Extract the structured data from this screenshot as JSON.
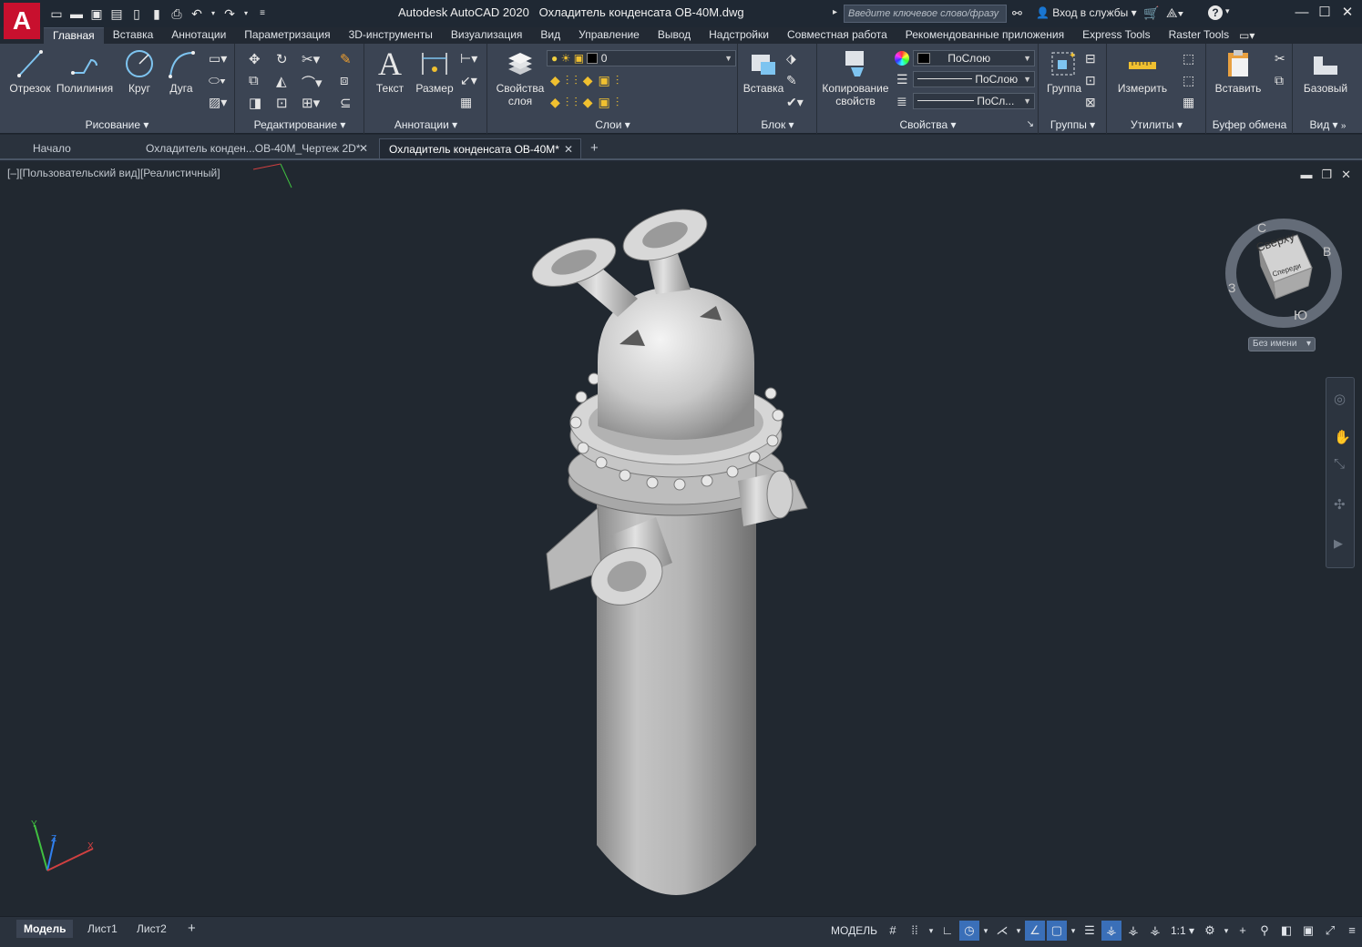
{
  "app": {
    "logo_letter": "A",
    "title": "Autodesk AutoCAD 2020",
    "filename": "Охладитель конденсата ОВ-40М.dwg",
    "search_placeholder": "Введите ключевое слово/фразу",
    "signin_label": "Вход в службы"
  },
  "ribbon_tabs": [
    "Главная",
    "Вставка",
    "Аннотации",
    "Параметризация",
    "3D-инструменты",
    "Визуализация",
    "Вид",
    "Управление",
    "Вывод",
    "Надстройки",
    "Совместная работа",
    "Рекомендованные приложения",
    "Express Tools",
    "Raster Tools"
  ],
  "active_tab": "Главная",
  "panels": {
    "draw": {
      "title": "Рисование",
      "buttons": [
        "Отрезок",
        "Полилиния",
        "Круг",
        "Дуга"
      ]
    },
    "modify": {
      "title": "Редактирование"
    },
    "annotation": {
      "title": "Аннотации",
      "buttons": [
        "Текст",
        "Размер"
      ]
    },
    "layers": {
      "title": "Слои",
      "props_label_1": "Свойства",
      "props_label_2": "слоя",
      "layer_name": "0"
    },
    "block": {
      "title": "Блок",
      "insert_label": "Вставка"
    },
    "properties": {
      "title": "Свойства",
      "match_label_1": "Копирование",
      "match_label_2": "свойств",
      "color": "ПоСлою",
      "linetype": "ПоСлою",
      "lineweight": "ПоСл..."
    },
    "groups": {
      "title": "Группы",
      "group_label": "Группа"
    },
    "utilities": {
      "title": "Утилиты",
      "measure_label": "Измерить"
    },
    "clipboard": {
      "title": "Буфер обмена",
      "paste_label": "Вставить"
    },
    "view": {
      "title": "Вид",
      "base_label": "Базовый"
    }
  },
  "doc_tabs": [
    {
      "label": "Начало",
      "closable": false,
      "active": false
    },
    {
      "label": "Охладитель конден...ОВ-40М_Чертеж 2D*",
      "closable": true,
      "active": false
    },
    {
      "label": "Охладитель конденсата ОВ-40М*",
      "closable": true,
      "active": true
    }
  ],
  "viewport": {
    "view_label": "[–][Пользовательский вид][Реалистичный]",
    "viewcube_face": "Сверху",
    "viewcube_sub": "Спереди",
    "compass": {
      "n": "С",
      "e": "В",
      "w": "З",
      "s": "Ю"
    },
    "ucs_menu": "Без имени"
  },
  "layout_tabs": [
    "Модель",
    "Лист1",
    "Лист2"
  ],
  "status": {
    "space": "МОДЕЛЬ",
    "scale": "1:1"
  },
  "colors": {
    "accent": "#3a6fb8",
    "logo": "#c8102e",
    "ribbon_bg": "#3b4453",
    "viewport_bg": "#212830"
  }
}
